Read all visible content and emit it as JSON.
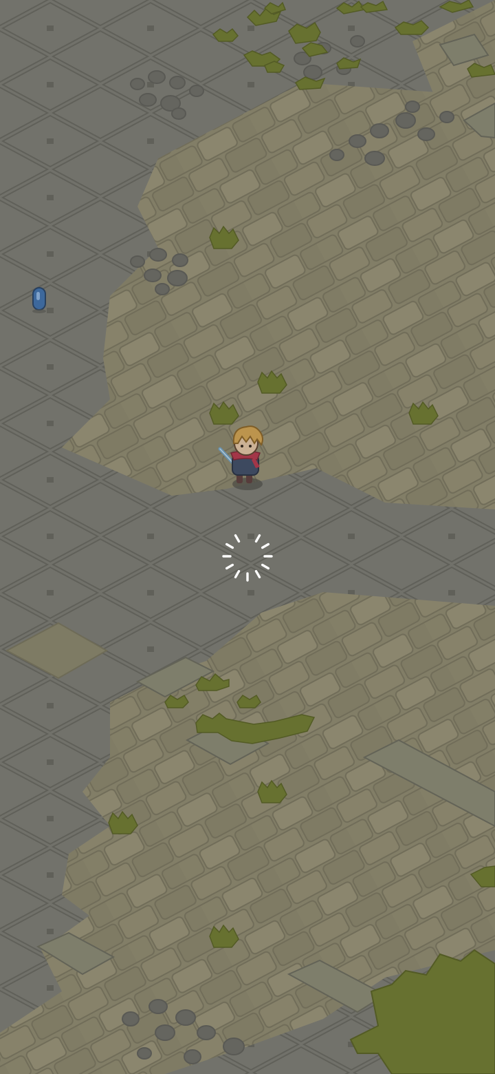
{
  "scene": {
    "name": "isometric-dungeon-floor",
    "state": "loading"
  },
  "colors": {
    "stone_tile": "#7a7a73",
    "stone_grout": "#63635d",
    "sand_tile": "#8f8a6f",
    "sand_tile_light": "#9a9478",
    "sand_grout": "#77735c",
    "moss": "#6e7a2c",
    "moss_dark": "#56601f",
    "pebble": "#6c6c66",
    "spinner": "#ffffff",
    "player_hair": "#d6a550",
    "player_scarf": "#b8334a",
    "player_body": "#3b4a66",
    "player_sword": "#6fa3c9",
    "gem": "#3b6fb0"
  },
  "player": {
    "name": "blond-swordsman",
    "facing": "south-west"
  },
  "pickups": [
    {
      "name": "blue-gem",
      "kind": "crystal"
    }
  ],
  "loading_indicator": {
    "icon": "loading-spinner-icon"
  }
}
